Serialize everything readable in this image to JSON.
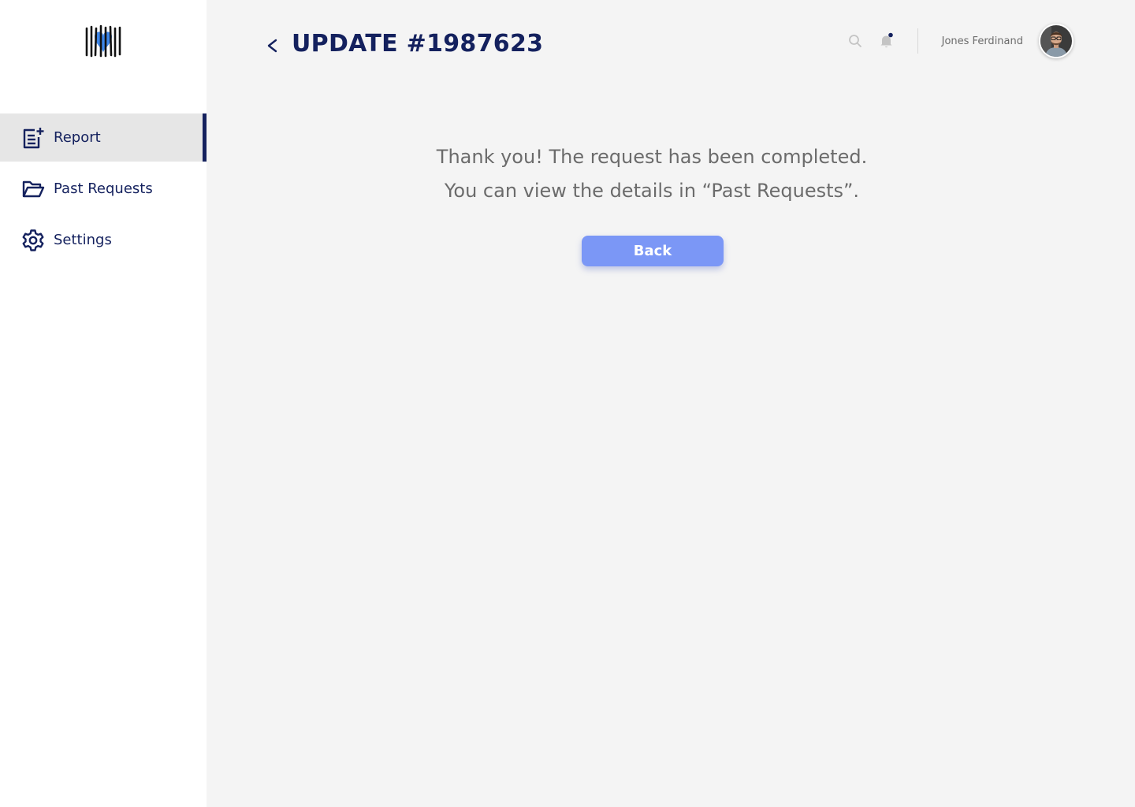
{
  "colors": {
    "primary": "#14215e",
    "accent": "#7b97f6",
    "text_muted": "#6b6b6b",
    "logo_blue": "#3d86e8"
  },
  "sidebar": {
    "items": [
      {
        "label": "Report",
        "icon": "report-add-icon",
        "active": true
      },
      {
        "label": "Past Requests",
        "icon": "folder-open-icon",
        "active": false
      },
      {
        "label": "Settings",
        "icon": "gear-icon",
        "active": false
      }
    ]
  },
  "header": {
    "title": "UPDATE #1987623",
    "user_name": "Jones Ferdinand"
  },
  "main": {
    "message_line1": "Thank you! The request has been completed.",
    "message_line2": "You can view the details in “Past Requests”.",
    "back_button_label": "Back"
  }
}
